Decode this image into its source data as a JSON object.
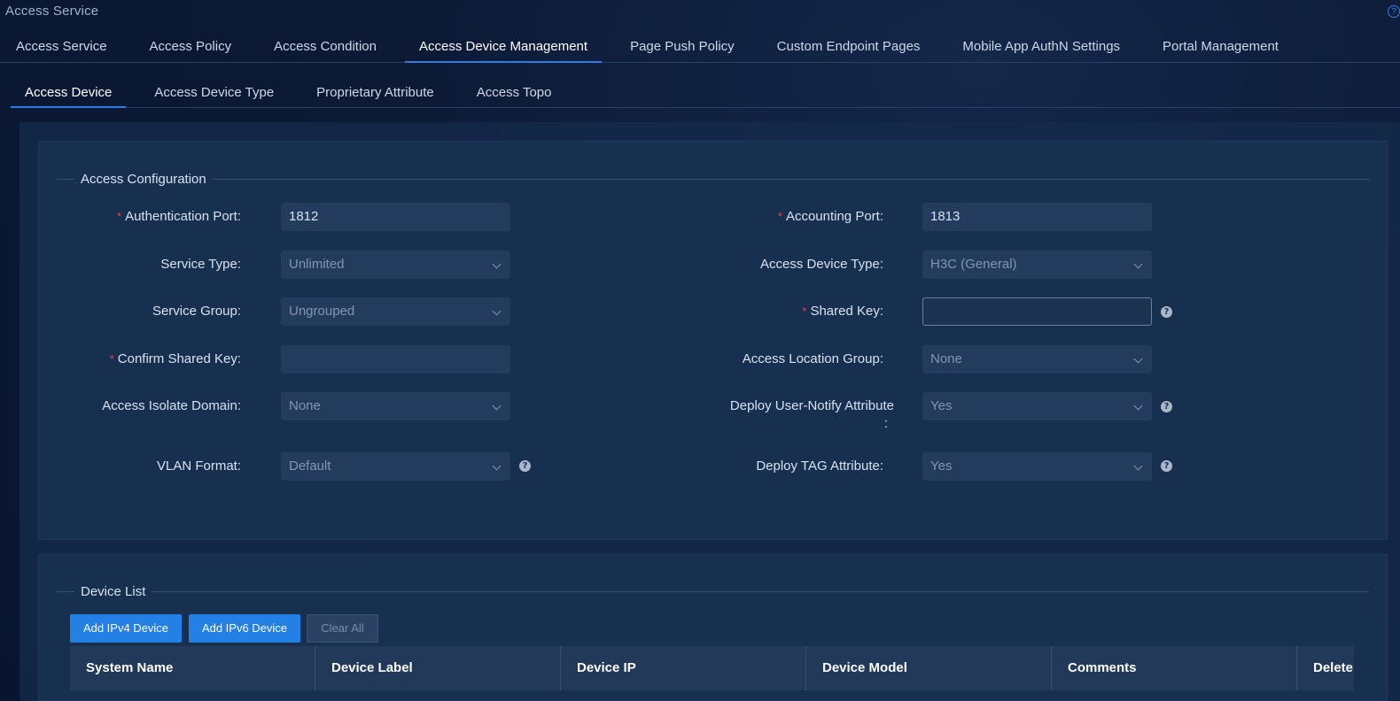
{
  "page": {
    "title": "Access Service"
  },
  "top_tabs": [
    {
      "label": "Access Service"
    },
    {
      "label": "Access Policy"
    },
    {
      "label": "Access Condition"
    },
    {
      "label": "Access Device Management"
    },
    {
      "label": "Page Push Policy"
    },
    {
      "label": "Custom Endpoint Pages"
    },
    {
      "label": "Mobile App AuthN Settings"
    },
    {
      "label": "Portal Management"
    }
  ],
  "top_tabs_active": "Access Device Management",
  "sub_tabs": [
    {
      "label": "Access Device"
    },
    {
      "label": "Access Device Type"
    },
    {
      "label": "Proprietary Attribute"
    },
    {
      "label": "Access Topo"
    }
  ],
  "sub_tabs_active": "Access Device",
  "access_config": {
    "legend": "Access Configuration",
    "required_mark": "*",
    "auth_port": {
      "label": "Authentication Port:",
      "value": "1812"
    },
    "accounting_port": {
      "label": "Accounting Port:",
      "value": "1813"
    },
    "service_type": {
      "label": "Service Type:",
      "value": "Unlimited"
    },
    "access_device_type": {
      "label": "Access Device Type:",
      "value": "H3C (General)"
    },
    "service_group": {
      "label": "Service Group:",
      "value": "Ungrouped"
    },
    "shared_key": {
      "label": "Shared Key:",
      "value": ""
    },
    "confirm_shared_key": {
      "label": "Confirm Shared Key:",
      "value": ""
    },
    "access_location_group": {
      "label": "Access Location Group:",
      "value": "None"
    },
    "access_isolate_domain": {
      "label": "Access Isolate Domain:",
      "value": "None"
    },
    "deploy_user_notify": {
      "label": "Deploy User-Notify Attribute",
      "colon": ":",
      "value": "Yes"
    },
    "vlan_format": {
      "label": "VLAN Format:",
      "value": "Default"
    },
    "deploy_tag": {
      "label": "Deploy TAG Attribute:",
      "value": "Yes"
    }
  },
  "device_list": {
    "legend": "Device List",
    "buttons": {
      "add_ipv4": "Add IPv4 Device",
      "add_ipv6": "Add IPv6 Device",
      "clear_all": "Clear All"
    },
    "columns": [
      "System Name",
      "Device Label",
      "Device IP",
      "Device Model",
      "Comments",
      "Delete"
    ]
  },
  "icons": {
    "help": "question-circle-icon",
    "chevron": "chevron-down-icon",
    "help_glyph": "?"
  },
  "colors": {
    "accent": "#2f7de0",
    "required": "#e5404f",
    "primary_button": "#2580e6"
  }
}
